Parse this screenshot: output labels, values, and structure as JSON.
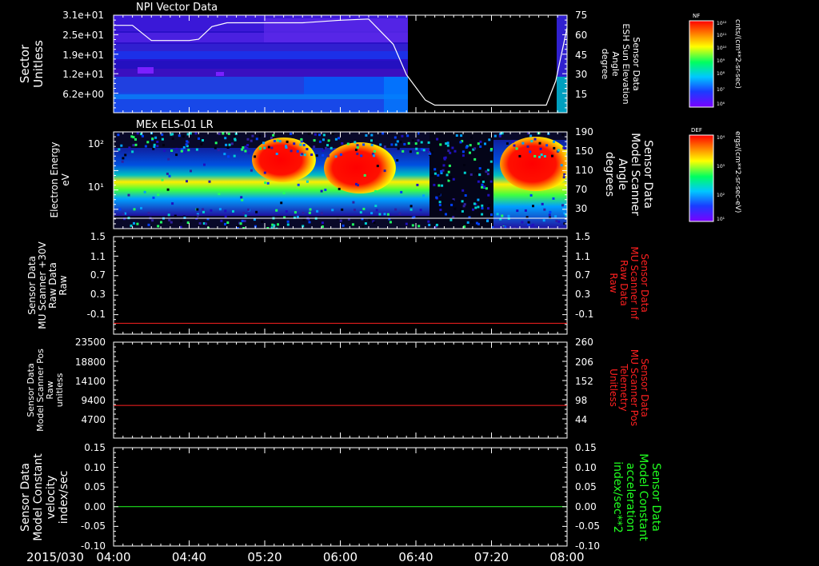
{
  "date_label": "2015/030",
  "x_ticks": [
    "04:00",
    "04:40",
    "05:20",
    "06:00",
    "06:40",
    "07:20",
    "08:00"
  ],
  "x_hours": [
    4.0,
    8.0
  ],
  "panels": [
    {
      "id": "npi",
      "title": "NPI Vector Data",
      "type": "spectrogram",
      "left_label": [
        "Sector",
        "Unitless"
      ],
      "left_ticks": [
        "3.1e+01",
        "2.5e+01",
        "1.9e+01",
        "1.2e+01",
        "6.2e+00"
      ],
      "right_label": [
        "Sensor Data",
        "ESH Sun Elevation",
        "Angle",
        "degree"
      ],
      "right_ticks": [
        "75",
        "60",
        "45",
        "30",
        "15"
      ],
      "colorbar": {
        "title": "NF",
        "unit": "cnts/(cm**2-sr-sec)",
        "ticks": [
          "10¹²",
          "10¹¹",
          "10¹⁰",
          "10⁹",
          "10⁸",
          "10⁷",
          "10⁶"
        ]
      },
      "overlay_color": "#ffffff"
    },
    {
      "id": "els",
      "title": "MEx ELS-01 LR",
      "type": "spectrogram",
      "left_label": [
        "Electron Energy",
        "eV"
      ],
      "left_ticks": [
        "10²",
        "10¹"
      ],
      "right_label": [
        "Sensor Data",
        "Model Scanner",
        "Angle",
        "degrees"
      ],
      "right_ticks": [
        "190",
        "150",
        "110",
        "70",
        "30"
      ],
      "colorbar": {
        "title": "DEF",
        "unit": "ergs/(cm**2-sr-sec-eV)",
        "ticks": [
          "10⁴",
          "10³",
          "10²",
          "10¹"
        ]
      },
      "overlay_color": "#ffffff"
    },
    {
      "id": "mu_raw",
      "type": "line",
      "left_label": [
        "Sensor Data",
        "MU Scanner +30V",
        "Raw Data",
        "Raw"
      ],
      "left_ticks": [
        "1.5",
        "1.1",
        "0.7",
        "0.3",
        "-0.1"
      ],
      "right_label": [
        "Sensor Data",
        "MU Scanner Inf",
        "Raw Data",
        "Raw"
      ],
      "right_ticks": [
        "1.5",
        "1.1",
        "0.7",
        "0.3",
        "-0.1"
      ],
      "right_label_color": "#ff2020",
      "line_color": "#ff2020"
    },
    {
      "id": "pos",
      "type": "line",
      "left_label": [
        "Sensor Data",
        "Model Scanner Pos",
        "Raw",
        "unitless"
      ],
      "left_ticks": [
        "23500",
        "18800",
        "14100",
        "9400",
        "4700"
      ],
      "right_label": [
        "Sensor Data",
        "MU Scanner Pos",
        "Telemetry",
        "Unitless"
      ],
      "right_ticks": [
        "260",
        "206",
        "152",
        "98",
        "44"
      ],
      "right_label_color": "#ff2020",
      "line_color": "#ff2020"
    },
    {
      "id": "vel",
      "type": "line",
      "left_label": [
        "Sensor Data",
        "Model Constant",
        "velocity",
        "index/sec"
      ],
      "left_ticks": [
        "0.15",
        "0.10",
        "0.05",
        "0.00",
        "-0.05",
        "-0.10"
      ],
      "right_label": [
        "Sensor Data",
        "Model Constant",
        "acceleration",
        "index/sec**2"
      ],
      "right_ticks": [
        "0.15",
        "0.10",
        "0.05",
        "0.00",
        "-0.05",
        "-0.10"
      ],
      "right_label_color": "#20ff20",
      "line_color": "#20ff20"
    }
  ],
  "chart_data": [
    {
      "type": "heatmap",
      "title": "NPI Vector Data",
      "ylabel": "Sector Unitless",
      "y2label": "Sensor Data ESH Sun Elevation Angle degree",
      "y_ticks": [
        31,
        25,
        19,
        12,
        6.2
      ],
      "y2_ticks": [
        75,
        60,
        45,
        30,
        15
      ],
      "no_data_interval": [
        "06:31",
        "07:56"
      ],
      "overlay_series": {
        "name": "ESH Sun Elevation Angle",
        "x": [
          "04:00",
          "04:10",
          "04:15",
          "04:20",
          "04:30",
          "04:40",
          "04:45",
          "04:52",
          "05:00",
          "05:20",
          "05:40",
          "06:00",
          "06:15",
          "06:28",
          "06:35",
          "06:45",
          "06:50",
          "07:00",
          "07:20",
          "07:40",
          "07:49",
          "07:54",
          "08:00"
        ],
        "y": [
          69,
          69,
          63,
          57,
          57,
          57,
          58,
          68,
          71,
          71,
          71,
          73,
          74,
          54,
          30,
          10,
          6,
          6,
          6,
          6,
          6,
          25,
          67
        ]
      }
    },
    {
      "type": "heatmap",
      "title": "MEx ELS-01 LR",
      "ylabel": "Electron Energy eV",
      "y2label": "Sensor Data Model Scanner Angle degrees",
      "y2_ticks": [
        190,
        150,
        110,
        70,
        30
      ],
      "overlay_series": {
        "name": "Model Scanner Angle",
        "x": [
          "04:00",
          "08:00"
        ],
        "y": [
          12,
          12
        ]
      }
    },
    {
      "type": "line",
      "ylabel": "Sensor Data MU Scanner +30V Raw Data Raw",
      "y2label": "Sensor Data MU Scanner Inf Raw Data Raw",
      "ylim": [
        -0.3,
        1.5
      ],
      "series": [
        {
          "x": [
            "04:00",
            "08:00"
          ],
          "values": [
            -0.1,
            -0.1
          ]
        }
      ]
    },
    {
      "type": "line",
      "ylabel": "Sensor Data Model Scanner Pos Raw unitless",
      "y2label": "Sensor Data MU Scanner Pos Telemetry Unitless",
      "ylim": [
        0,
        23500
      ],
      "series": [
        {
          "x": [
            "04:00",
            "08:00"
          ],
          "values": [
            8000,
            8000
          ]
        }
      ]
    },
    {
      "type": "line",
      "ylabel": "Sensor Data Model Constant velocity index/sec",
      "y2label": "Sensor Data Model Constant acceleration index/sec**2",
      "ylim": [
        -0.1,
        0.15
      ],
      "series": [
        {
          "x": [
            "04:00",
            "08:00"
          ],
          "values": [
            0.0,
            0.0
          ]
        }
      ]
    }
  ]
}
